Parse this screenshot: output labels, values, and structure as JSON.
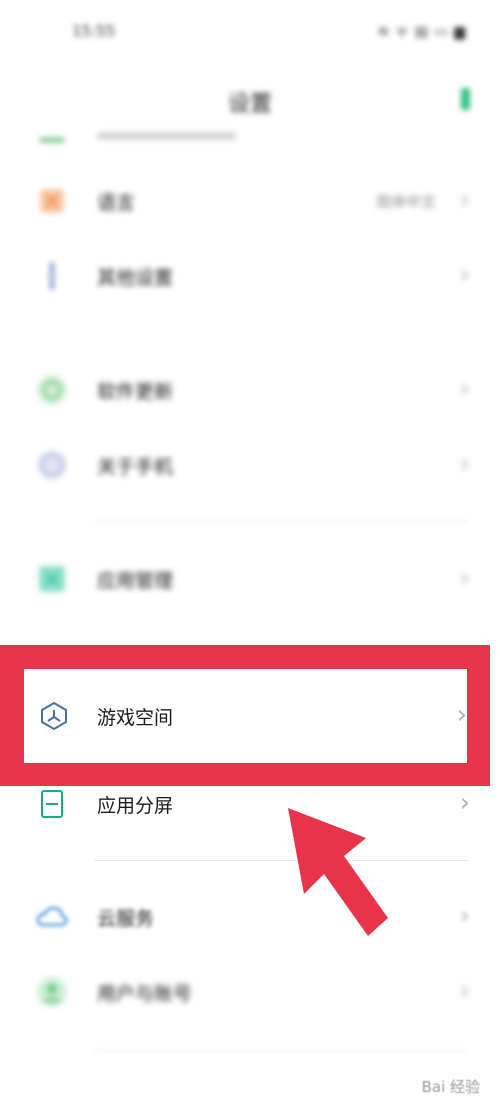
{
  "status_bar": {
    "time": "15:55",
    "icons": "≋ ᯤ ▤ ▭ ▆"
  },
  "header": {
    "title": "设置"
  },
  "rows": [
    {
      "label": "语言",
      "value": "简体中文",
      "chevron": "›",
      "icon": "language-icon",
      "color": "#f3a46c"
    },
    {
      "label": "其他设置",
      "chevron": "›",
      "icon": "more-settings-icon",
      "color": "#7b8cc7"
    },
    {
      "label": "软件更新",
      "chevron": "›",
      "icon": "software-update-icon",
      "color": "#7fcf8a"
    },
    {
      "label": "关于手机",
      "chevron": "›",
      "icon": "about-phone-icon",
      "color": "#a6acd6"
    },
    {
      "label": "应用管理",
      "chevron": "›",
      "icon": "app-management-icon",
      "color": "#2fbfa0"
    },
    {
      "label": "游戏空间",
      "chevron": "›",
      "icon": "game-space-icon",
      "color": "#4a6fa5"
    },
    {
      "label": "应用分屏",
      "chevron": "›",
      "icon": "split-screen-icon",
      "color": "#1aa889"
    },
    {
      "label": "云服务",
      "chevron": "›",
      "icon": "cloud-service-icon",
      "color": "#3a87d6"
    },
    {
      "label": "用户与账号",
      "chevron": "›",
      "icon": "user-account-icon",
      "color": "#6fc984"
    }
  ],
  "annotation": {
    "frame_color": "#e8344a",
    "arrow_color": "#e8344a"
  },
  "watermark": {
    "text": "Bai 经验"
  }
}
